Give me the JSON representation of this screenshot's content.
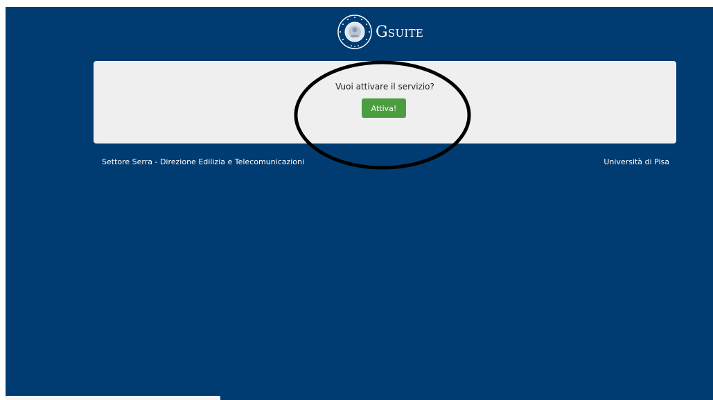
{
  "header": {
    "logo_text": "Gsuite"
  },
  "card": {
    "question": "Vuoi attivare il servizio?",
    "activate_label": "Attiva!"
  },
  "footer": {
    "left_text": "Settore Serra - Direzione Edilizia e Telecomunicazioni",
    "right_text": "Università di Pisa"
  },
  "colors": {
    "background": "#003c71",
    "card": "#efefef",
    "button": "#4b9e3f"
  },
  "icons": {
    "seal": "university-seal-icon"
  }
}
